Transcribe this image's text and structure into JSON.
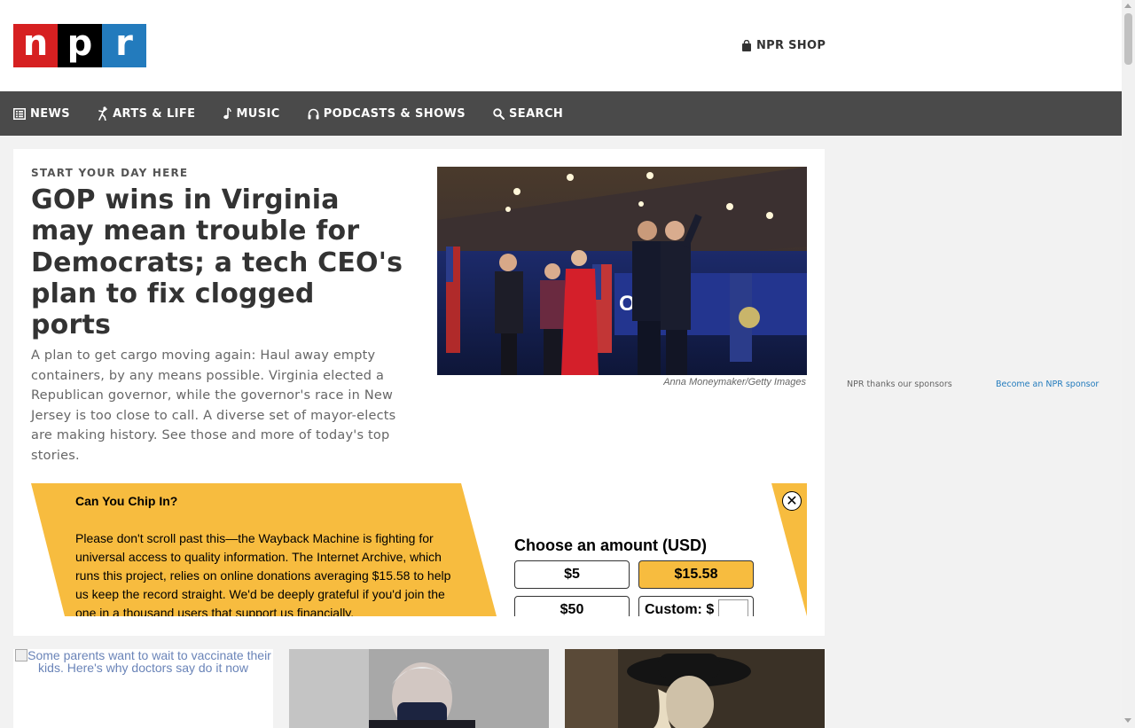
{
  "header": {
    "logo_letters": [
      "n",
      "p",
      "r"
    ],
    "shop_label": "NPR SHOP",
    "colors": {
      "logo_n": "#d62021",
      "logo_p": "#000000",
      "logo_r": "#237bbd",
      "nav_bg": "#4a4a4a"
    }
  },
  "nav": {
    "items": [
      {
        "label": "NEWS",
        "icon": "news-list-icon"
      },
      {
        "label": "ARTS & LIFE",
        "icon": "dancer-icon"
      },
      {
        "label": "MUSIC",
        "icon": "music-note-icon"
      },
      {
        "label": "PODCASTS & SHOWS",
        "icon": "headphones-icon"
      },
      {
        "label": "SEARCH",
        "icon": "search-icon"
      }
    ]
  },
  "story": {
    "kicker": "START YOUR DAY HERE",
    "headline": "GOP wins in Virginia may mean trouble for Democrats; a tech CEO's plan to fix clogged ports",
    "teaser": "A plan to get cargo moving again: Haul away empty containers, by any means possible. Virginia elected a Republican governor, while the governor's race in New Jersey is too close to call. A diverse set of mayor-elects are making history. See those and more of today's top stories.",
    "photo_credit": "Anna Moneymaker/Getty Images"
  },
  "donate": {
    "title": "Can You Chip In?",
    "body": "Please don't scroll past this—the Wayback Machine is fighting for universal access to quality information. The Internet Archive, which runs this project, relies on online donations averaging $15.58 to help us keep the record straight. We'd be deeply grateful if you'd join the one in a thousand users that support us financially.",
    "choose_label": "Choose an amount (USD)",
    "amounts": [
      "$5",
      "$15.58",
      "$50"
    ],
    "selected": "$15.58",
    "custom_label": "Custom: $",
    "close_glyph": "✕",
    "accent_color": "#f7bc3f"
  },
  "tiles": {
    "first_alt": "Some parents want to wait to vaccinate their kids. Here's why doctors say do it now"
  },
  "sidebar": {
    "thanks": "NPR thanks our sponsors",
    "become_sponsor": "Become an NPR sponsor"
  }
}
